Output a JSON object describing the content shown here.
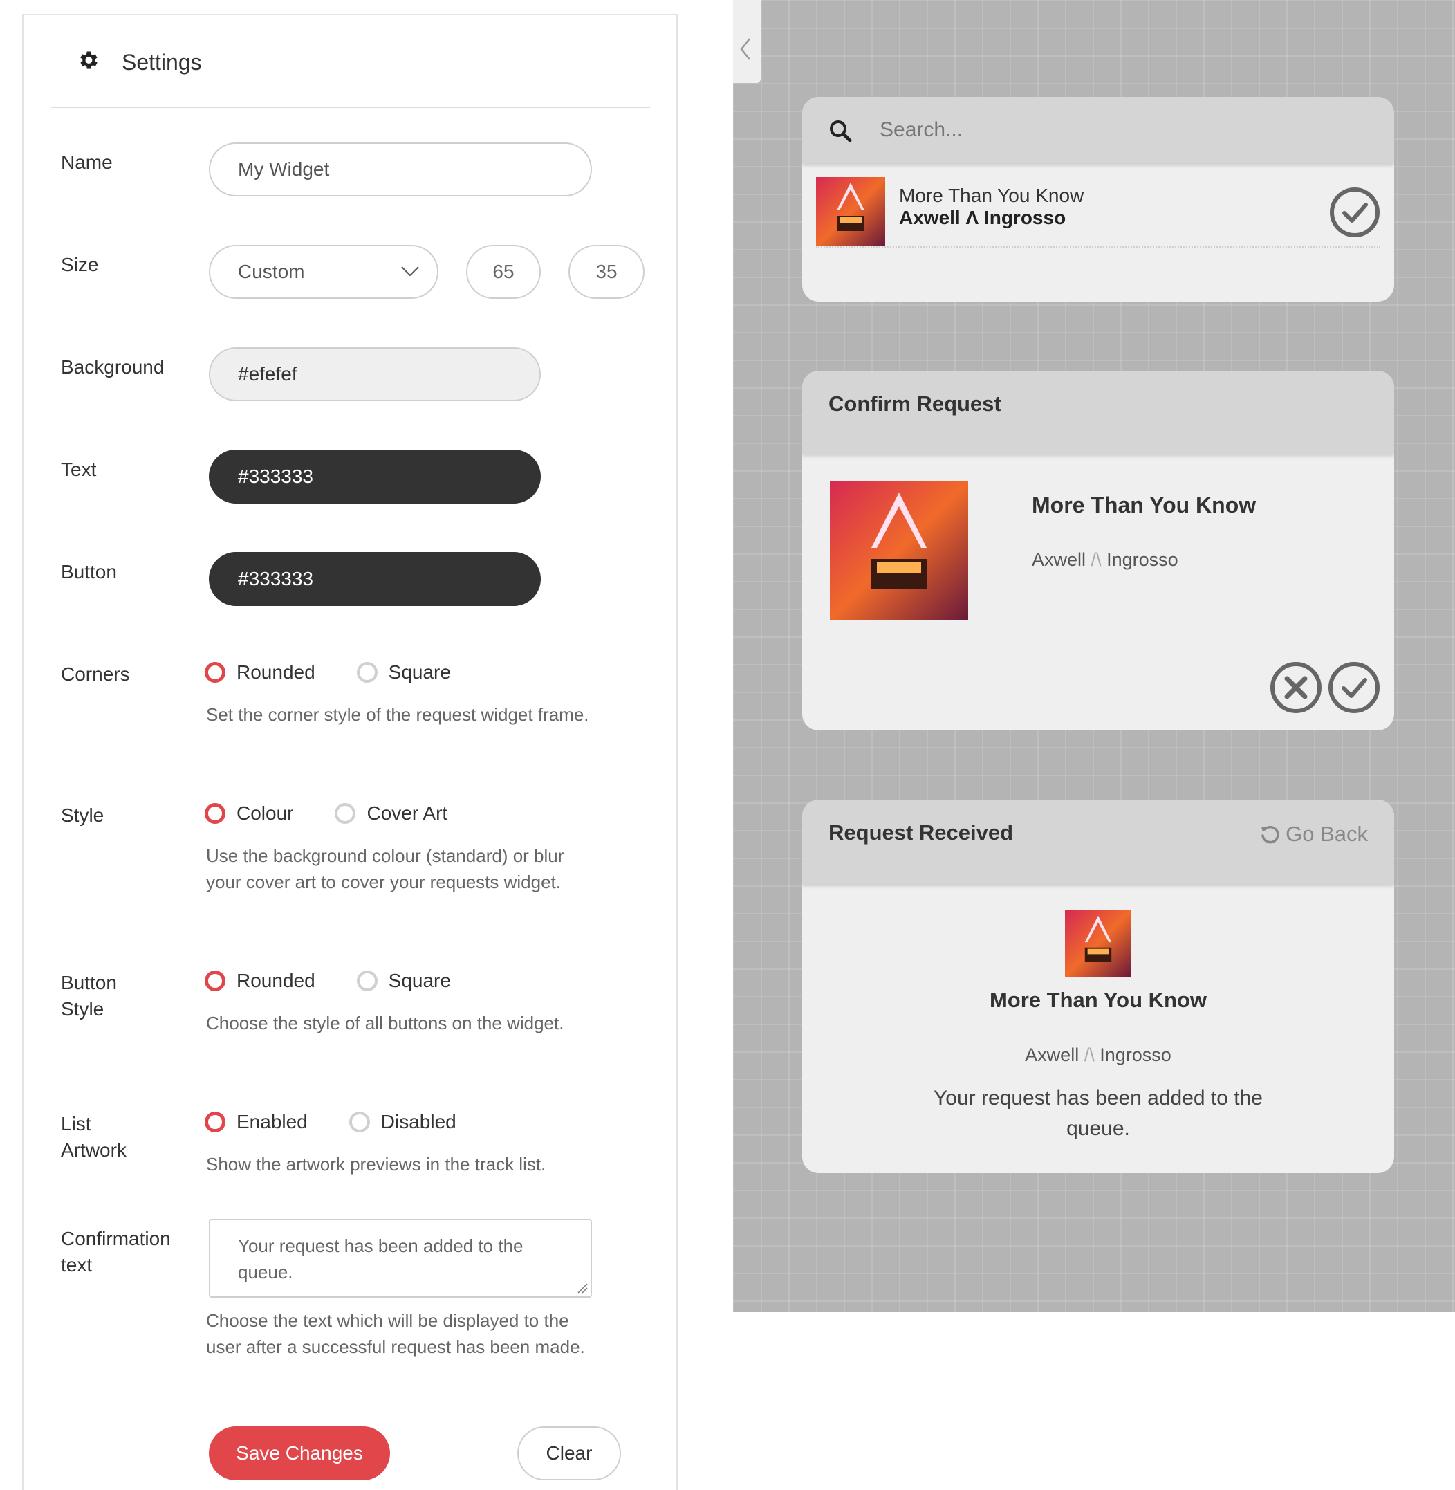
{
  "settings": {
    "title": "Settings",
    "name_label": "Name",
    "name_value": "My Widget",
    "size_label": "Size",
    "size_select": "Custom",
    "size_width": "65",
    "size_height": "35",
    "background_label": "Background",
    "background_value": "#efefef",
    "text_label": "Text",
    "text_value": "#333333",
    "button_label": "Button",
    "button_value": "#333333",
    "corners": {
      "label": "Corners",
      "options": [
        "Rounded",
        "Square"
      ],
      "selected": "Rounded",
      "help": "Set the corner style of the request widget frame."
    },
    "style": {
      "label": "Style",
      "options": [
        "Colour",
        "Cover Art"
      ],
      "selected": "Colour",
      "help": "Use the background colour (standard) or blur your cover art to cover your requests widget."
    },
    "button_style": {
      "label_line1": "Button",
      "label_line2": "Style",
      "options": [
        "Rounded",
        "Square"
      ],
      "selected": "Rounded",
      "help": "Choose the style of all buttons on the widget."
    },
    "list_artwork": {
      "label_line1": "List",
      "label_line2": "Artwork",
      "options": [
        "Enabled",
        "Disabled"
      ],
      "selected": "Enabled",
      "help": "Show the artwork previews in the track list."
    },
    "confirmation": {
      "label_line1": "Confirmation",
      "label_line2": "text",
      "value": "Your request has been added to the queue.",
      "help": "Choose the text which will be displayed to the user after a successful request has been made."
    },
    "save_label": "Save Changes",
    "clear_label": "Clear"
  },
  "preview": {
    "search": {
      "placeholder": "Search...",
      "result_title": "More Than You Know",
      "result_artist": "Axwell Λ Ingrosso"
    },
    "confirm": {
      "title": "Confirm Request",
      "track": "More Than You Know",
      "artist_a": "Axwell",
      "artist_sep": "/\\",
      "artist_b": "Ingrosso"
    },
    "received": {
      "title": "Request Received",
      "go_back": "Go Back",
      "track": "More Than You Know",
      "artist_a": "Axwell",
      "artist_sep": "/\\",
      "artist_b": "Ingrosso",
      "message": "Your request has been added to the queue."
    }
  },
  "colors": {
    "accent": "#e0464a",
    "widget_bg": "#efefef",
    "widget_text": "#333333",
    "preview_bg": "#b4b4b4"
  }
}
